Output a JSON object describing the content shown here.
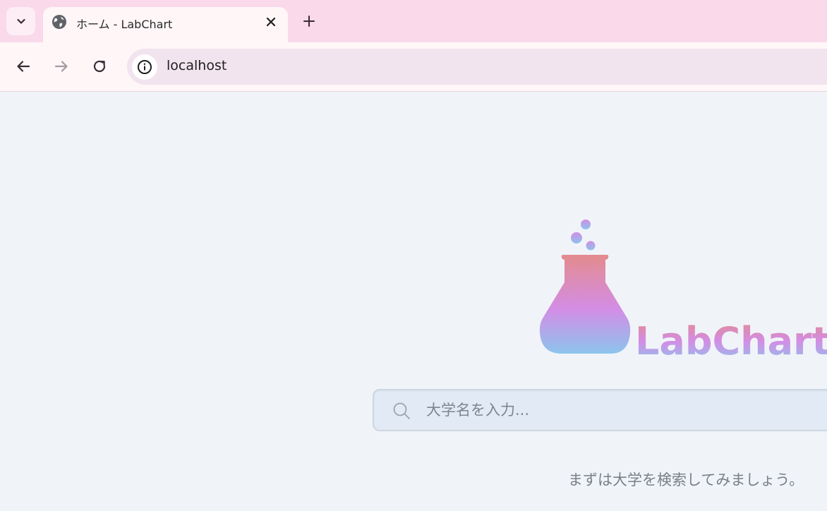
{
  "browser": {
    "tab": {
      "title": "ホーム - LabChart",
      "favicon": "globe-icon"
    },
    "address_bar": {
      "url": "localhost",
      "site_info_icon": "info-icon"
    },
    "icons": {
      "tab_search": "chevron-down-icon",
      "tab_close": "close-icon",
      "new_tab": "plus-icon",
      "back": "arrow-left-icon",
      "forward": "arrow-right-icon",
      "reload": "reload-icon"
    }
  },
  "page": {
    "logo": {
      "wordmark": "LabChart",
      "icon": "flask-icon",
      "gradient": [
        "#e38b8d",
        "#d38de5",
        "#8cc4ec"
      ]
    },
    "search": {
      "placeholder": "大学名を入力...",
      "value": "",
      "icon": "search-icon"
    },
    "hint": "まずは大学を検索してみましょう。"
  },
  "colors": {
    "tabstrip": "#f9d9ea",
    "toolbar": "#fff6f8",
    "omnibox": "#f2e4ee",
    "page_background": "#f0f4f9",
    "search_background": "#e2ebf5"
  }
}
